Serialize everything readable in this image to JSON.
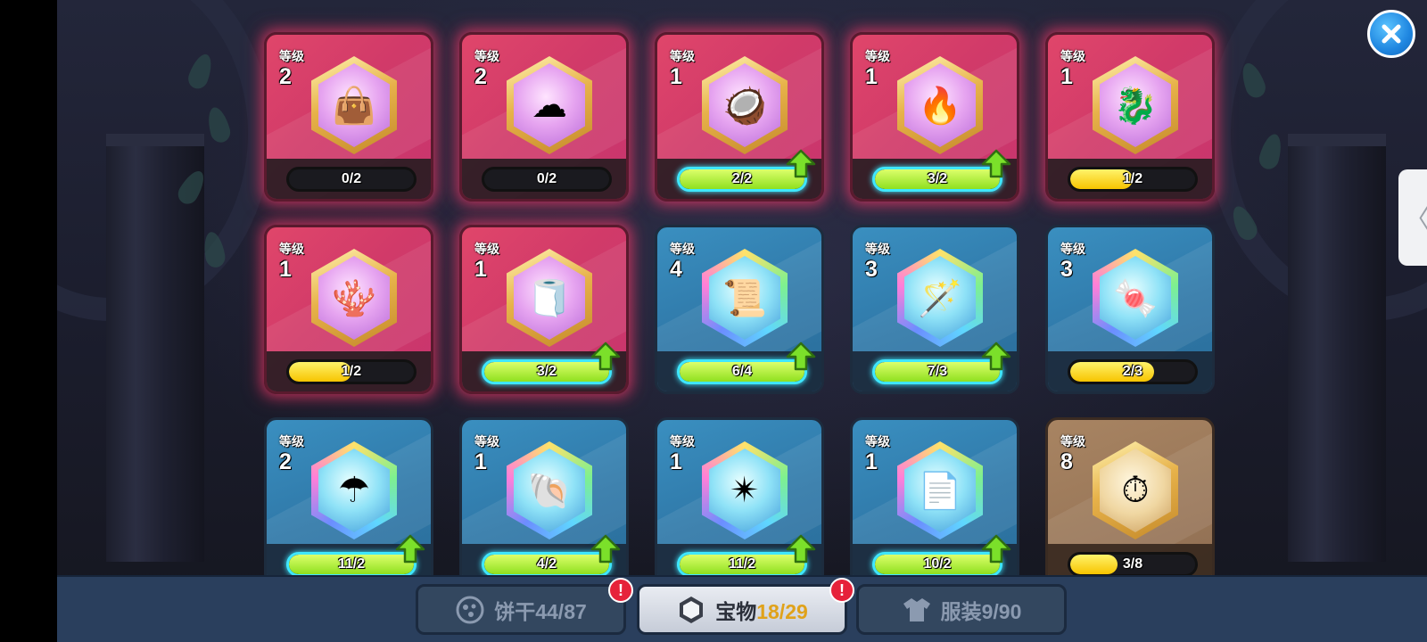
{
  "level_label": "等级",
  "items": [
    {
      "level": "2",
      "progress": "0/2",
      "fill": 0.0,
      "theme": "red",
      "icon": "burlap-sack-icon",
      "glyph": "👜",
      "upgrade": false
    },
    {
      "level": "2",
      "progress": "0/2",
      "fill": 0.0,
      "theme": "red",
      "icon": "crystal-cloud-icon",
      "glyph": "☁",
      "upgrade": false
    },
    {
      "level": "1",
      "progress": "2/2",
      "fill": 1.0,
      "theme": "red",
      "icon": "poison-bag-icon",
      "glyph": "🥥",
      "upgrade": true
    },
    {
      "level": "1",
      "progress": "3/2",
      "fill": 1.0,
      "theme": "red",
      "icon": "fire-crown-icon",
      "glyph": "🔥",
      "upgrade": true
    },
    {
      "level": "1",
      "progress": "1/2",
      "fill": 0.5,
      "theme": "red",
      "icon": "sea-dragon-icon",
      "glyph": "🐉",
      "upgrade": false
    },
    {
      "level": "1",
      "progress": "1/2",
      "fill": 0.5,
      "theme": "red",
      "icon": "coral-icon",
      "glyph": "🪸",
      "upgrade": false
    },
    {
      "level": "1",
      "progress": "3/2",
      "fill": 1.0,
      "theme": "red",
      "icon": "bandage-mummy-icon",
      "glyph": "🧻",
      "upgrade": true
    },
    {
      "level": "4",
      "progress": "6/4",
      "fill": 1.0,
      "theme": "blue",
      "icon": "scroll-icon",
      "glyph": "📜",
      "upgrade": true
    },
    {
      "level": "3",
      "progress": "7/3",
      "fill": 1.0,
      "theme": "blue",
      "icon": "magic-staff-icon",
      "glyph": "🪄",
      "upgrade": true
    },
    {
      "level": "3",
      "progress": "2/3",
      "fill": 0.67,
      "theme": "blue",
      "icon": "candy-icon",
      "glyph": "🍬",
      "upgrade": false
    },
    {
      "level": "2",
      "progress": "11/2",
      "fill": 1.0,
      "theme": "blue",
      "icon": "umbrella-bone-icon",
      "glyph": "☂",
      "upgrade": true
    },
    {
      "level": "1",
      "progress": "4/2",
      "fill": 1.0,
      "theme": "blue",
      "icon": "ghost-shell-icon",
      "glyph": "🐚",
      "upgrade": true
    },
    {
      "level": "1",
      "progress": "11/2",
      "fill": 1.0,
      "theme": "blue",
      "icon": "dark-crystal-icon",
      "glyph": "✴",
      "upgrade": true
    },
    {
      "level": "1",
      "progress": "10/2",
      "fill": 1.0,
      "theme": "blue",
      "icon": "cursed-paper-icon",
      "glyph": "📄",
      "upgrade": true
    },
    {
      "level": "8",
      "progress": "3/8",
      "fill": 0.38,
      "theme": "brown",
      "icon": "stopwatch-icon",
      "glyph": "⏱",
      "upgrade": false
    }
  ],
  "tabs": [
    {
      "label": "饼干",
      "count": "44/87",
      "icon": "cookie-icon",
      "alert": "!",
      "active": false
    },
    {
      "label": "宝物",
      "count": "18/29",
      "icon": "treasure-icon",
      "alert": "!",
      "active": true
    },
    {
      "label": "服装",
      "count": "9/90",
      "icon": "costume-icon",
      "alert": "",
      "active": false
    }
  ],
  "side_tab": "〈",
  "colors": {
    "red_card": "#d13a69",
    "blue_card": "#2f78a8",
    "brown_card": "#8f6e52",
    "ready_bar": "#8fe01f",
    "partial_bar": "#f7c400",
    "active_count": "#e0a21a"
  }
}
